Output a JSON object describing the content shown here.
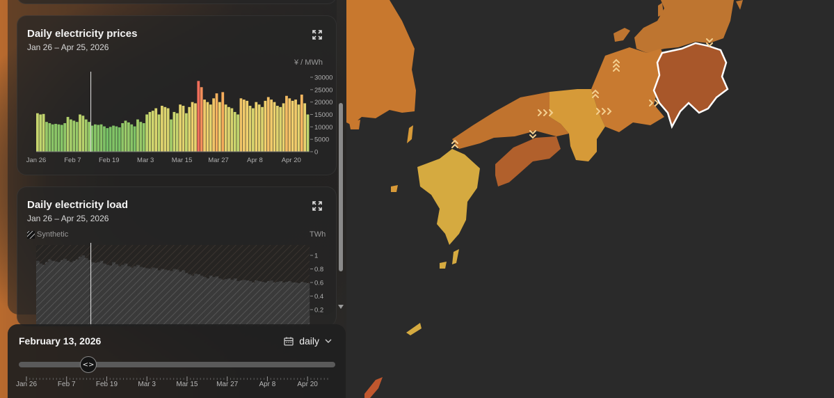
{
  "prices_card": {
    "title": "Daily electricity prices",
    "subtitle": "Jan 26 – Apr 25, 2026",
    "unit": "¥ / MWh",
    "expand_icon": "expand-icon"
  },
  "load_card": {
    "title": "Daily electricity load",
    "subtitle": "Jan 26 – Apr 25, 2026",
    "legend_synthetic": "Synthetic",
    "unit": "TWh",
    "expand_icon": "expand-icon"
  },
  "timeline": {
    "date": "February 13, 2026",
    "granularity": "daily",
    "calendar_icon": "calendar-icon",
    "chevron_icon": "chevron-down-icon",
    "slider_icon": "code-arrows-icon",
    "slider_value_index": 18,
    "labels": [
      "Jan 26",
      "Feb 7",
      "Feb 19",
      "Mar 3",
      "Mar 15",
      "Mar 27",
      "Apr 8",
      "Apr 20"
    ]
  },
  "chart_data": [
    {
      "type": "bar",
      "title": "Daily electricity prices",
      "subtitle": "Jan 26 – Apr 25, 2026",
      "ylabel": "¥ / MWh",
      "ylim": [
        0,
        30000
      ],
      "yticks": [
        0,
        5000,
        10000,
        15000,
        20000,
        25000,
        30000
      ],
      "xtick_labels": [
        "Jan 26",
        "Feb 7",
        "Feb 19",
        "Mar 3",
        "Mar 15",
        "Mar 27",
        "Apr 8",
        "Apr 20"
      ],
      "x_start": "2026-01-26",
      "marker_date": "2026-02-13",
      "values": [
        15500,
        15000,
        15200,
        12000,
        11500,
        11000,
        11200,
        11000,
        10800,
        11500,
        14000,
        13000,
        12500,
        12000,
        15000,
        14500,
        13000,
        12000,
        10500,
        11000,
        10800,
        11000,
        10200,
        9500,
        10000,
        10500,
        10200,
        9800,
        11500,
        12500,
        11800,
        11000,
        10200,
        13000,
        12000,
        11500,
        15000,
        16000,
        16500,
        17500,
        15000,
        18500,
        18000,
        17500,
        13000,
        16000,
        15500,
        19000,
        18500,
        15500,
        18000,
        20000,
        19500,
        28500,
        26000,
        21000,
        20000,
        19000,
        21500,
        23500,
        20000,
        24000,
        19000,
        18000,
        17500,
        16000,
        15000,
        21500,
        21000,
        20500,
        18500,
        17500,
        20000,
        19000,
        18000,
        20500,
        22000,
        21000,
        20000,
        18500,
        18000,
        19500,
        22500,
        21500,
        20500,
        21000,
        19000,
        23000,
        19500,
        15000
      ]
    },
    {
      "type": "area",
      "title": "Daily electricity load",
      "subtitle": "Jan 26 – Apr 25, 2026",
      "ylabel": "TWh",
      "yticks": [
        0.2,
        0.4,
        0.6,
        0.8,
        1
      ],
      "legend": [
        "Synthetic"
      ],
      "values": [
        0.92,
        0.88,
        0.86,
        0.9,
        0.94,
        0.92,
        0.91,
        0.9,
        0.93,
        0.95,
        0.92,
        0.9,
        0.92,
        0.94,
        0.98,
        1.0,
        0.96,
        0.93,
        0.9,
        0.89,
        0.9,
        0.92,
        0.88,
        0.86,
        0.85,
        0.9,
        0.87,
        0.84,
        0.86,
        0.88,
        0.84,
        0.82,
        0.84,
        0.86,
        0.83,
        0.82,
        0.81,
        0.8,
        0.82,
        0.81,
        0.78,
        0.8,
        0.79,
        0.78,
        0.77,
        0.8,
        0.79,
        0.76,
        0.78,
        0.74,
        0.72,
        0.7,
        0.73,
        0.72,
        0.7,
        0.68,
        0.66,
        0.7,
        0.68,
        0.69,
        0.66,
        0.64,
        0.65,
        0.66,
        0.64,
        0.66,
        0.62,
        0.63,
        0.64,
        0.63,
        0.62,
        0.6,
        0.63,
        0.62,
        0.61,
        0.6,
        0.62,
        0.63,
        0.6,
        0.61,
        0.62,
        0.6,
        0.61,
        0.62,
        0.6,
        0.6,
        0.59,
        0.61,
        0.6,
        0.59
      ]
    }
  ]
}
